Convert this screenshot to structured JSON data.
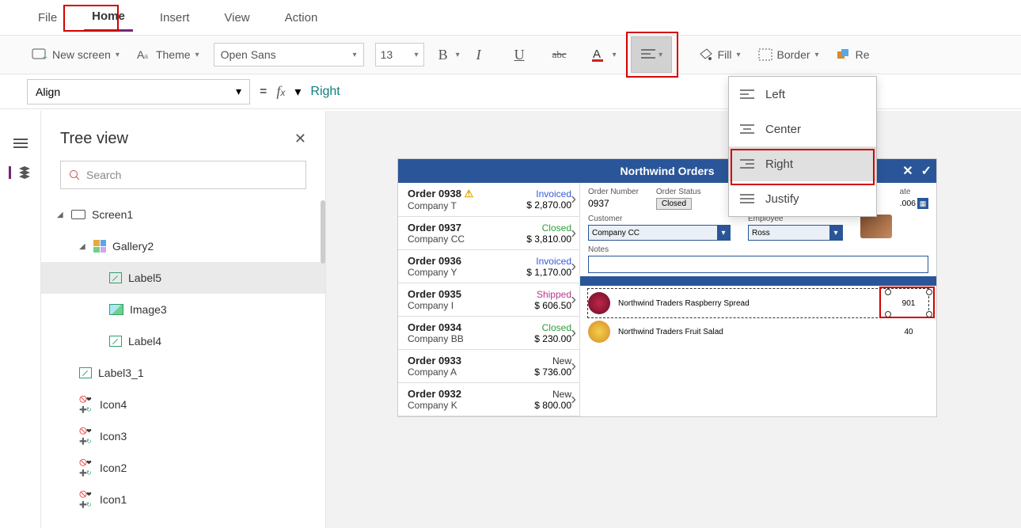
{
  "menu": {
    "file": "File",
    "home": "Home",
    "insert": "Insert",
    "view": "View",
    "action": "Action"
  },
  "ribbon": {
    "new_screen": "New screen",
    "theme": "Theme",
    "font": "Open Sans",
    "size": "13",
    "fill": "Fill",
    "border": "Border",
    "reorder": "Re"
  },
  "fbar": {
    "property": "Align",
    "formula": "Right"
  },
  "tree": {
    "title": "Tree view",
    "search_placeholder": "Search",
    "screen1": "Screen1",
    "gallery2": "Gallery2",
    "label5": "Label5",
    "image3": "Image3",
    "label4": "Label4",
    "label3_1": "Label3_1",
    "icon4": "Icon4",
    "icon3": "Icon3",
    "icon2": "Icon2",
    "icon1": "Icon1"
  },
  "app": {
    "title": "Northwind Orders",
    "orders": [
      {
        "num": "Order 0938",
        "company": "Company T",
        "status": "Invoiced",
        "amount": "$ 2,870.00",
        "warn": true
      },
      {
        "num": "Order 0937",
        "company": "Company CC",
        "status": "Closed",
        "amount": "$ 3,810.00"
      },
      {
        "num": "Order 0936",
        "company": "Company Y",
        "status": "Invoiced",
        "amount": "$ 1,170.00"
      },
      {
        "num": "Order 0935",
        "company": "Company I",
        "status": "Shipped",
        "amount": "$ 606.50"
      },
      {
        "num": "Order 0934",
        "company": "Company BB",
        "status": "Closed",
        "amount": "$ 230.00"
      },
      {
        "num": "Order 0933",
        "company": "Company A",
        "status": "New",
        "amount": "$ 736.00"
      },
      {
        "num": "Order 0932",
        "company": "Company K",
        "status": "New",
        "amount": "$ 800.00"
      }
    ],
    "detail": {
      "order_number_lbl": "Order Number",
      "order_number": "0937",
      "order_status_lbl": "Order Status",
      "order_status": "Closed",
      "date_lbl": "ate",
      "date": ".006",
      "customer_lbl": "Customer",
      "customer": "Company CC",
      "employee_lbl": "Employee",
      "employee": "Ross",
      "notes_lbl": "Notes",
      "items": [
        {
          "name": "Northwind Traders Raspberry Spread",
          "qty": "901"
        },
        {
          "name": "Northwind Traders Fruit Salad",
          "qty": "40"
        }
      ]
    }
  },
  "alignmenu": {
    "left": "Left",
    "center": "Center",
    "right": "Right",
    "justify": "Justify"
  }
}
